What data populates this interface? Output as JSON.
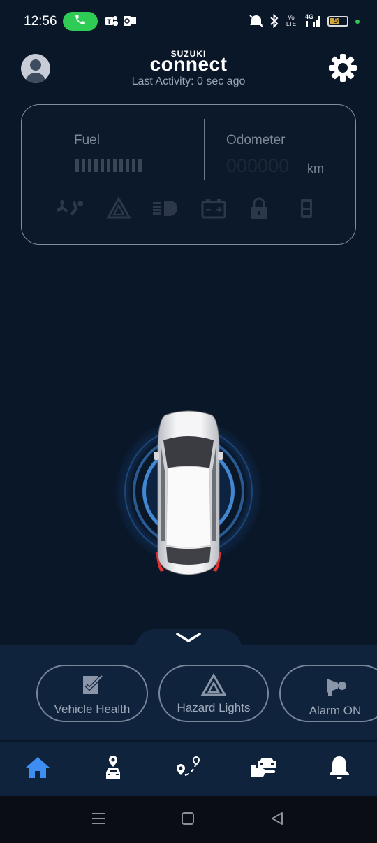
{
  "status_bar": {
    "time": "12:56",
    "battery_level": "55",
    "net_label": "4G",
    "volte_label": "Vo LTE",
    "icons": [
      "call-icon",
      "teams-icon",
      "outlook-icon",
      "mute-icon",
      "bluetooth-icon",
      "volte-icon",
      "signal-icon",
      "battery-icon"
    ]
  },
  "header": {
    "brand_top": "SUZUKI",
    "brand_main": "connect",
    "last_activity": "Last Activity: 0 sec ago"
  },
  "vehicle_info": {
    "fuel_label": "Fuel",
    "fuel_bar_count": 11,
    "odometer_label": "Odometer",
    "odometer_value": "000000",
    "odometer_unit": "km",
    "status_icons": [
      "ac-icon",
      "hazard-icon",
      "headlight-icon",
      "battery-icon",
      "lock-icon",
      "door-icon"
    ]
  },
  "quick_actions": [
    {
      "label": "Vehicle Health",
      "icon": "vehicle-health-icon"
    },
    {
      "label": "Hazard Lights",
      "icon": "hazard-icon"
    },
    {
      "label": "Alarm ON",
      "icon": "alarm-horn-icon"
    }
  ],
  "bottom_nav": [
    {
      "id": "home",
      "icon": "home-icon",
      "active": true
    },
    {
      "id": "locate",
      "icon": "car-location-icon",
      "active": false
    },
    {
      "id": "trips",
      "icon": "route-icon",
      "active": false
    },
    {
      "id": "service",
      "icon": "service-icon",
      "active": false
    },
    {
      "id": "alerts",
      "icon": "bell-icon",
      "active": false
    }
  ],
  "colors": {
    "background": "#091729",
    "panel": "#10233d",
    "active_nav": "#3d8ef0",
    "call_pill": "#2ecc55"
  }
}
